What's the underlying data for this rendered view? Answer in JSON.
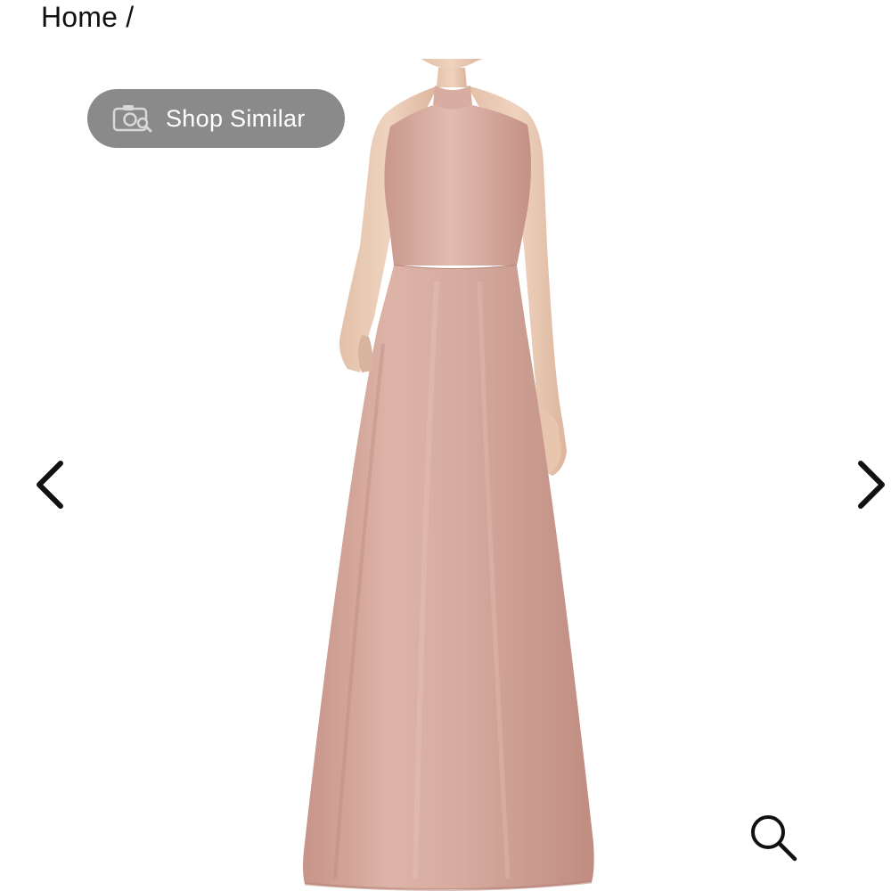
{
  "breadcrumb": {
    "text": "Home /"
  },
  "shop_similar": {
    "label": "Shop Similar",
    "icon": "camera-search-icon"
  },
  "gallery": {
    "product_image": "blush-pink-satin-halter-maxi-gown",
    "prev_icon": "chevron-left-icon",
    "next_icon": "chevron-right-icon",
    "zoom_icon": "magnifier-icon"
  },
  "colors": {
    "dress": "#d4a99e",
    "pill_background": "#8a8a8a",
    "text": "#111111"
  }
}
